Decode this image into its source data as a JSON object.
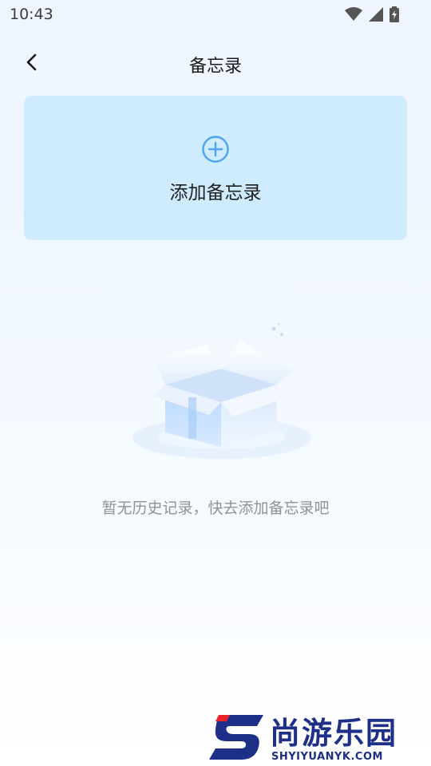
{
  "status": {
    "time": "10:43"
  },
  "header": {
    "title": "备忘录"
  },
  "add_card": {
    "label": "添加备忘录"
  },
  "empty_state": {
    "message": "暂无历史记录，快去添加备忘录吧"
  },
  "watermark": {
    "brand": "尚游乐园",
    "url": "SHYIYUANYK.COM"
  },
  "colors": {
    "card_bg": "#cfecff",
    "accent": "#4da3f0",
    "watermark": "#1d2f86"
  }
}
